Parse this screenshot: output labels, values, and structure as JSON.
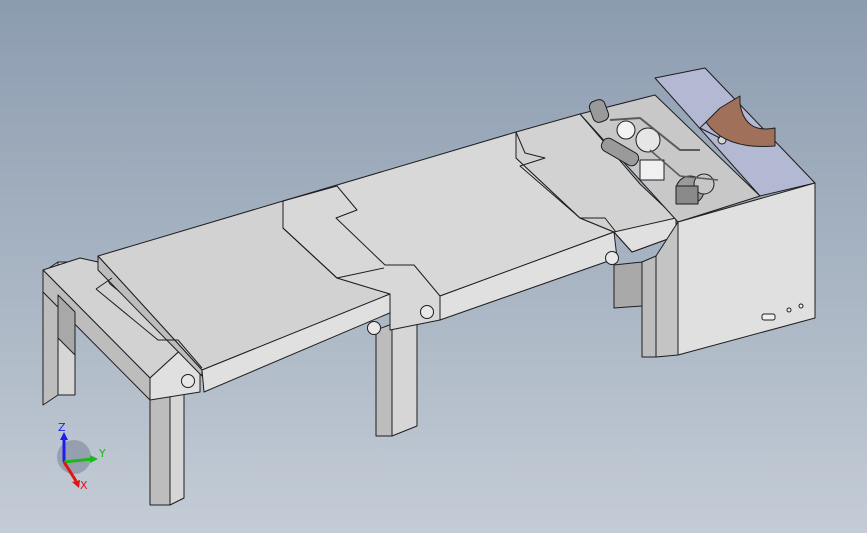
{
  "viewport": {
    "background_top": "#8c9cb0",
    "background_bottom": "#c4ccd6"
  },
  "model": {
    "face_top": "#d2d2d2",
    "face_front": "#e0e0e0",
    "face_side": "#bdbdbd",
    "edge": "#1e1e1e",
    "plate": "#b3b9d2",
    "bracket": "#a1705a",
    "machinery": "#9a9a9a"
  },
  "triad": {
    "labels": {
      "z": "Z",
      "y": "Y",
      "x": "X"
    },
    "colors": {
      "z": "#1d1df0",
      "y": "#1db81d",
      "x": "#e01414"
    }
  }
}
